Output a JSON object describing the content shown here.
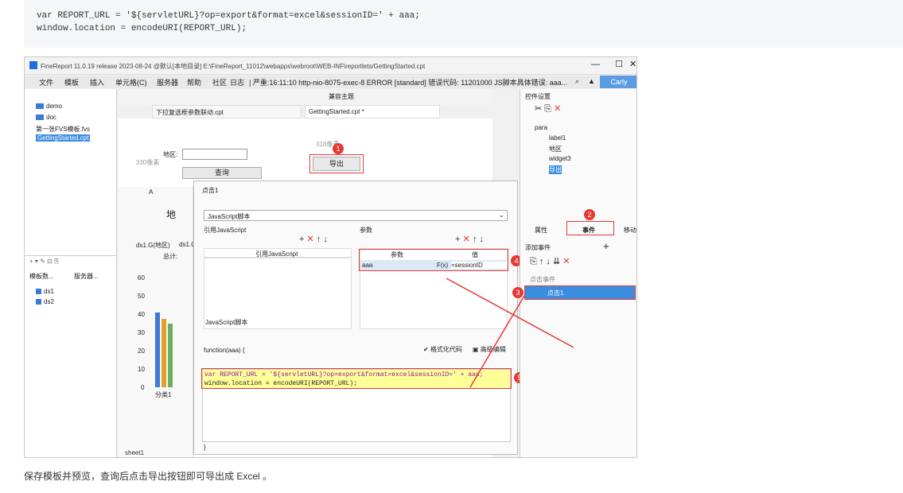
{
  "code_block": {
    "line1": "var REPORT_URL = '${servletURL}?op=export&format=excel&sessionID=' + aaa;",
    "line2": "window.location = encodeURI(REPORT_URL);"
  },
  "window": {
    "title": "FineReport 11.0.19 release 2023-08-24 @默认[本地目录]   E:\\FineReport_11012\\webapps\\webroot\\WEB-INF\\reportlets/GettingStarted.cpt",
    "user": "Carly"
  },
  "menu": [
    "文件",
    "模板",
    "插入",
    "单元格(C)",
    "服务器",
    "帮助",
    "社区",
    "日志"
  ],
  "status_text": "| 严重:16:11:10 http-nio-8075-exec-8 ERROR [standard] 错误代码: 11201000 JS脚本具体错误: aaa...",
  "tree_items": [
    "demo",
    "doc",
    "第一张FVS模板.fvs",
    "GettingStarted.cpt"
  ],
  "left_tabs": [
    "模板数...",
    "服务器..."
  ],
  "datasets": [
    "ds1",
    "ds2"
  ],
  "editor_tabs": [
    "下拉复选框参数联动.cpt",
    "GettingStarted.cpt *"
  ],
  "compat_label": "兼容主题",
  "param_area": {
    "label": "地区:",
    "query_button": "查询",
    "export_button": "导出",
    "hint_top": "318像素",
    "hint_left": "330像素"
  },
  "sheet": {
    "tab": "sheet1",
    "col_a": "A",
    "title_cell": "地",
    "cells": [
      "ds1.G(地区)",
      "ds1.C",
      "总计:"
    ],
    "yticks": [
      "60",
      "50",
      "40",
      "30",
      "20",
      "10",
      "0"
    ],
    "xcat": "分类1"
  },
  "dialog": {
    "title": "点击1",
    "type_select": "JavaScript脚本",
    "ref_js_label": "引用JavaScript",
    "ref_js_header": "引用JavaScript",
    "params_label": "参数",
    "param_col_name": "参数",
    "param_col_value": "值",
    "param_name": "aaa",
    "param_fx": "F(x)",
    "param_value": "=sessionID",
    "script_label": "JavaScript脚本",
    "func_header": "function(aaa) {",
    "format_code": "格式化代码",
    "advanced_edit": "高级编辑",
    "code_line1": "var REPORT_URL = '${servletURL}?op=export&format=excel&sessionID=' + aaa;",
    "code_line2": "window.location = encodeURI(REPORT_URL);",
    "close_brace": "}"
  },
  "right_panel": {
    "title": "控件设置",
    "widgets": [
      "para",
      "label1",
      "地区",
      "widget3",
      "导出"
    ],
    "tabs": [
      "属性",
      "事件",
      "移动端"
    ],
    "add_event": "添加事件",
    "event_group": "点击事件",
    "event_item": "点击1"
  },
  "badges": [
    "1",
    "2",
    "3",
    "4",
    "5"
  ],
  "caption": "保存模板并预览，查询后点击导出按钮即可导出成 Excel 。",
  "colors": {
    "accent": "#e53935",
    "selected": "#3b8de0",
    "highlight": "#ffff99",
    "codebg": "#f5f6f7"
  }
}
